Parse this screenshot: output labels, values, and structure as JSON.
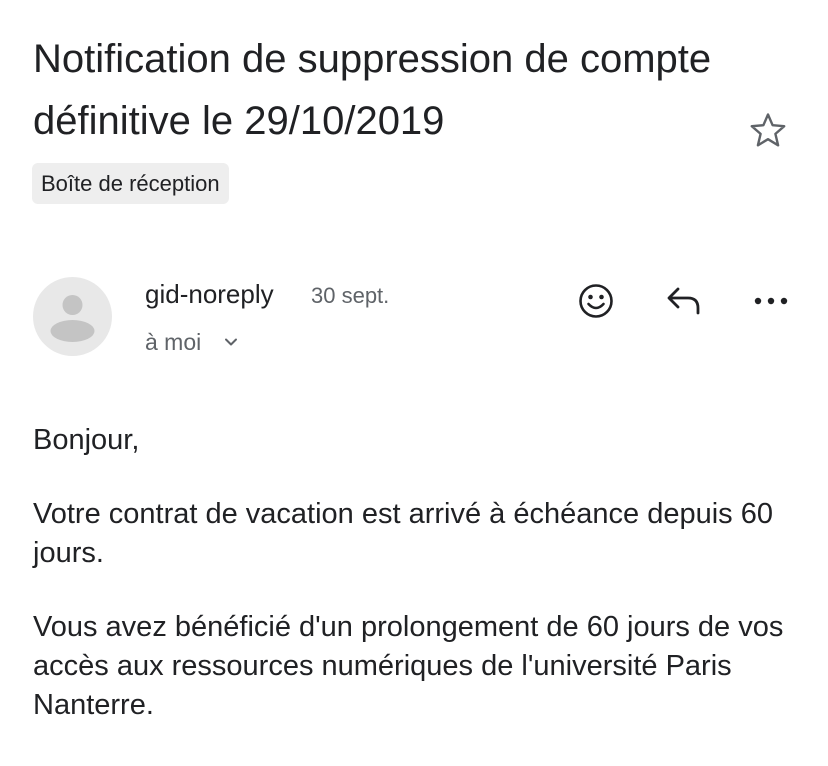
{
  "email": {
    "subject": "Notification de suppression de compte définitive le 29/10/2019",
    "label": "Boîte de réception",
    "starred": false
  },
  "message": {
    "sender": "gid-noreply",
    "date": "30 sept.",
    "recipient_label": "à moi",
    "body": [
      "Bonjour,",
      "Votre contrat de vacation est arrivé à échéance depuis 60 jours.",
      "Vous avez bénéficié d'un prolongement de 60 jours de vos accès aux ressources numériques de l'université Paris Nanterre."
    ]
  },
  "icons": {
    "star": "star-outline-icon",
    "avatar": "default-person-icon",
    "recipient_toggle": "chevron-down-icon",
    "emoji": "smiley-face-icon",
    "reply": "reply-arrow-icon",
    "more": "more-horizontal-icon"
  },
  "colors": {
    "text_primary": "#202124",
    "text_secondary": "#5f6368",
    "chip_background": "#eeeeee",
    "avatar_background": "#e8e8e8",
    "avatar_glyph": "#c4c4c4"
  }
}
